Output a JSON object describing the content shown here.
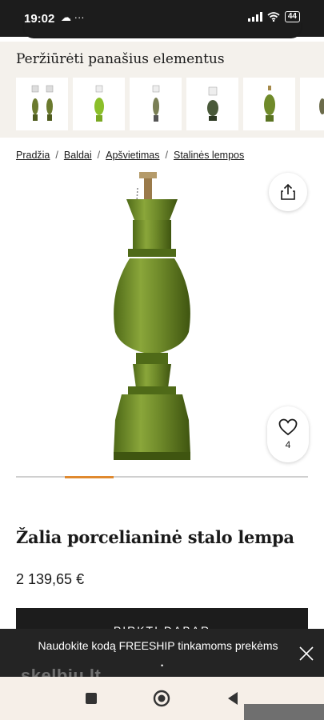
{
  "status_bar": {
    "time": "19:02",
    "notifications": "☁ ···",
    "battery": "44"
  },
  "similar": {
    "title": "Peržiūrėti panašius elementus",
    "thumbnails": [
      {
        "name": "pair-lamps"
      },
      {
        "name": "lime-lamp"
      },
      {
        "name": "slim-lamp"
      },
      {
        "name": "dark-lamp"
      },
      {
        "name": "green-vase-lamp"
      },
      {
        "name": "partial-lamp"
      }
    ]
  },
  "breadcrumb": {
    "items": [
      "Pradžia",
      "Baldai",
      "Apšvietimas",
      "Stalinės lempos"
    ],
    "separator": "/"
  },
  "gallery": {
    "slide_index": 2,
    "slide_count": 6
  },
  "favorites": {
    "count": "4"
  },
  "product": {
    "title": "Žalia porcelianinė stalo lempa",
    "price": "2 139,65 €",
    "buy_label": "PIRKTI DABAR"
  },
  "promo": {
    "text": "Naudokite kodą FREESHIP tinkamoms prekėms",
    "watermark": "skelbiu.lt"
  },
  "colors": {
    "accent": "#e0892e",
    "lamp_green": "#6f8a2a",
    "dark": "#1c1c1c"
  }
}
